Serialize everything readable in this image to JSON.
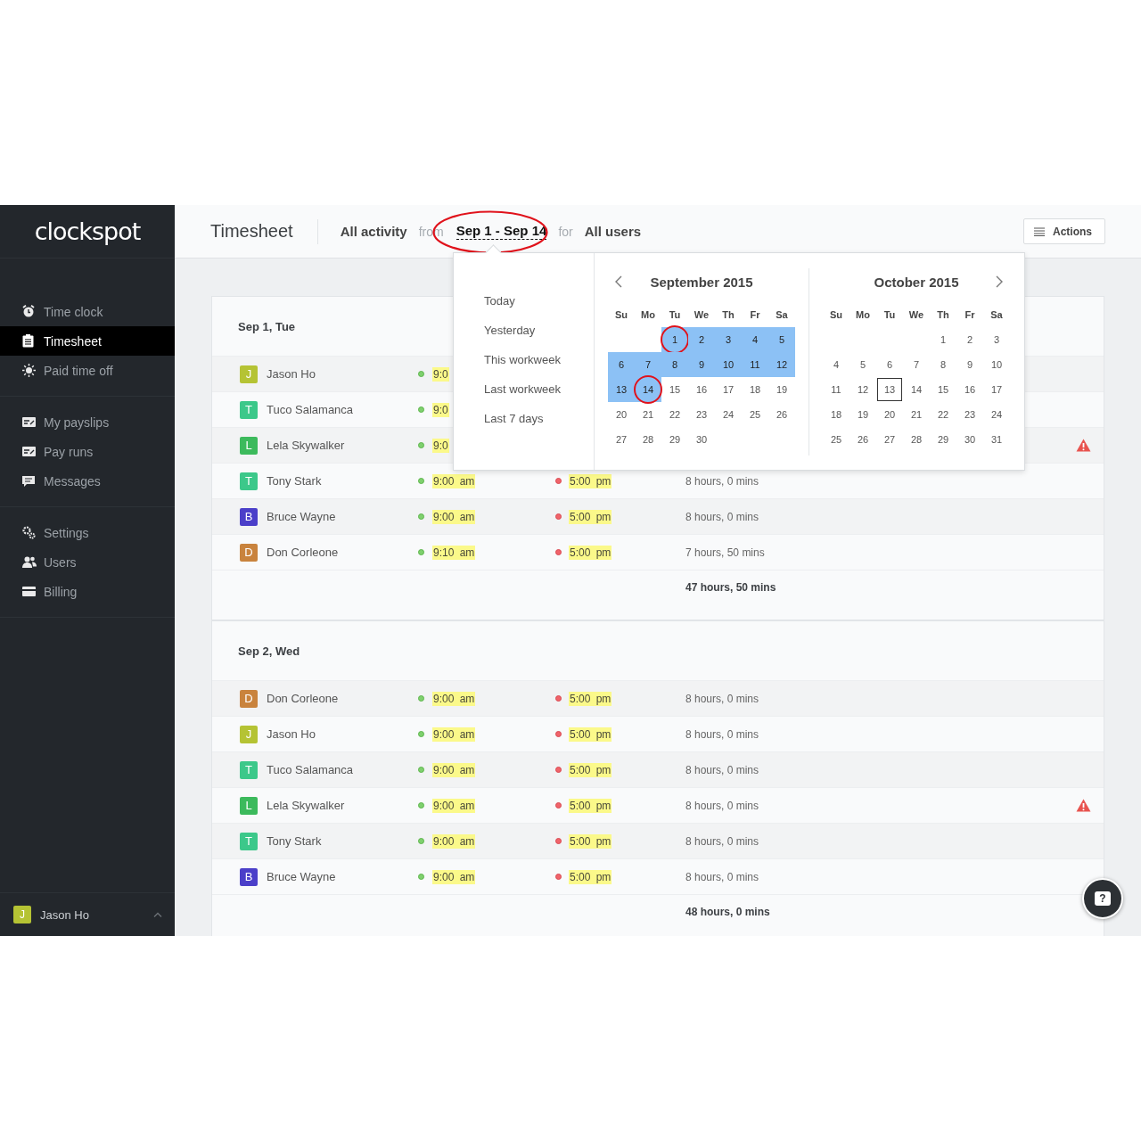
{
  "sidebar": {
    "logo": "clockspot",
    "groups": [
      {
        "items": [
          {
            "label": "Time clock",
            "selected": false
          },
          {
            "label": "Timesheet",
            "selected": true
          },
          {
            "label": "Paid time off",
            "selected": false
          }
        ]
      },
      {
        "items": [
          {
            "label": "My payslips",
            "selected": false
          },
          {
            "label": "Pay runs",
            "selected": false
          },
          {
            "label": "Messages",
            "selected": false
          }
        ]
      },
      {
        "items": [
          {
            "label": "Settings",
            "selected": false
          },
          {
            "label": "Users",
            "selected": false
          },
          {
            "label": "Billing",
            "selected": false
          }
        ]
      }
    ],
    "user": {
      "initial": "J",
      "name": "Jason Ho",
      "color": "#b5c334"
    }
  },
  "header": {
    "title": "Timesheet",
    "activity": "All activity",
    "from": "from",
    "range": "Sep 1 - Sep 14",
    "range_circled": true,
    "for": "for",
    "users": "All users",
    "actions": "Actions"
  },
  "days": [
    {
      "title": "Sep 1, Tue",
      "rows": [
        {
          "initial": "J",
          "name": "Jason Ho",
          "color": "#b5c334",
          "time_in": "9:0",
          "warning": false
        },
        {
          "initial": "T",
          "name": "Tuco Salamanca",
          "color": "#3cc88a",
          "time_in": "9:0",
          "warning": false
        },
        {
          "initial": "L",
          "name": "Lela Skywalker",
          "color": "#3cba5c",
          "time_in": "9:0",
          "warning": true
        },
        {
          "initial": "T",
          "name": "Tony Stark",
          "color": "#3cc88a",
          "time_in": "9:00 am",
          "time_out": "5:00 pm",
          "duration": "8 hours, 0 mins",
          "warning": false
        },
        {
          "initial": "B",
          "name": "Bruce Wayne",
          "color": "#4b3fc9",
          "time_in": "9:00 am",
          "time_out": "5:00 pm",
          "duration": "8 hours, 0 mins",
          "warning": false
        },
        {
          "initial": "D",
          "name": "Don Corleone",
          "color": "#c9833d",
          "time_in": "9:10 am",
          "time_out": "5:00 pm",
          "duration": "7 hours, 50 mins",
          "warning": false
        }
      ],
      "total": "47 hours, 50 mins"
    },
    {
      "title": "Sep 2, Wed",
      "rows": [
        {
          "initial": "D",
          "name": "Don Corleone",
          "color": "#c9833d",
          "time_in": "9:00 am",
          "time_out": "5:00 pm",
          "duration": "8 hours, 0 mins",
          "warning": false
        },
        {
          "initial": "J",
          "name": "Jason Ho",
          "color": "#b5c334",
          "time_in": "9:00 am",
          "time_out": "5:00 pm",
          "duration": "8 hours, 0 mins",
          "warning": false
        },
        {
          "initial": "T",
          "name": "Tuco Salamanca",
          "color": "#3cc88a",
          "time_in": "9:00 am",
          "time_out": "5:00 pm",
          "duration": "8 hours, 0 mins",
          "warning": false
        },
        {
          "initial": "L",
          "name": "Lela Skywalker",
          "color": "#3cba5c",
          "time_in": "9:00 am",
          "time_out": "5:00 pm",
          "duration": "8 hours, 0 mins",
          "warning": true
        },
        {
          "initial": "T",
          "name": "Tony Stark",
          "color": "#3cc88a",
          "time_in": "9:00 am",
          "time_out": "5:00 pm",
          "duration": "8 hours, 0 mins",
          "warning": false
        },
        {
          "initial": "B",
          "name": "Bruce Wayne",
          "color": "#4b3fc9",
          "time_in": "9:00 am",
          "time_out": "5:00 pm",
          "duration": "8 hours, 0 mins",
          "warning": false
        }
      ],
      "total": "48 hours, 0 mins"
    }
  ],
  "datepicker": {
    "presets": [
      "Today",
      "Yesterday",
      "This workweek",
      "Last workweek",
      "Last 7 days"
    ],
    "months": [
      {
        "title": "September 2015",
        "weekdays": [
          "Su",
          "Mo",
          "Tu",
          "We",
          "Th",
          "Fr",
          "Sa"
        ],
        "weeks": [
          [
            {
              "d": "1",
              "in_range": true,
              "circled": true,
              "today": false
            },
            {
              "d": "2",
              "in_range": true,
              "circled": false,
              "today": false
            },
            {
              "d": "3",
              "in_range": true,
              "circled": false,
              "today": false
            },
            {
              "d": "4",
              "in_range": true,
              "circled": false,
              "today": false
            },
            {
              "d": "5",
              "in_range": true,
              "circled": false,
              "today": false
            }
          ],
          [
            {
              "d": "6",
              "in_range": true,
              "circled": false,
              "today": false
            },
            {
              "d": "7",
              "in_range": true,
              "circled": false,
              "today": false
            },
            {
              "d": "8",
              "in_range": true,
              "circled": false,
              "today": false
            },
            {
              "d": "9",
              "in_range": true,
              "circled": false,
              "today": false
            },
            {
              "d": "10",
              "in_range": true,
              "circled": false,
              "today": false
            },
            {
              "d": "11",
              "in_range": true,
              "circled": false,
              "today": false
            },
            {
              "d": "12",
              "in_range": true,
              "circled": false,
              "today": false
            }
          ],
          [
            {
              "d": "13",
              "in_range": true,
              "circled": false,
              "today": false
            },
            {
              "d": "14",
              "in_range": true,
              "circled": true,
              "today": false
            },
            {
              "d": "15",
              "in_range": false,
              "circled": false,
              "today": false
            },
            {
              "d": "16",
              "in_range": false,
              "circled": false,
              "today": false
            },
            {
              "d": "17",
              "in_range": false,
              "circled": false,
              "today": false
            },
            {
              "d": "18",
              "in_range": false,
              "circled": false,
              "today": false
            },
            {
              "d": "19",
              "in_range": false,
              "circled": false,
              "today": false
            }
          ],
          [
            {
              "d": "20",
              "in_range": false,
              "circled": false,
              "today": false
            },
            {
              "d": "21",
              "in_range": false,
              "circled": false,
              "today": false
            },
            {
              "d": "22",
              "in_range": false,
              "circled": false,
              "today": false
            },
            {
              "d": "23",
              "in_range": false,
              "circled": false,
              "today": false
            },
            {
              "d": "24",
              "in_range": false,
              "circled": false,
              "today": false
            },
            {
              "d": "25",
              "in_range": false,
              "circled": false,
              "today": false
            },
            {
              "d": "26",
              "in_range": false,
              "circled": false,
              "today": false
            }
          ],
          [
            {
              "d": "27",
              "in_range": false,
              "circled": false,
              "today": false
            },
            {
              "d": "28",
              "in_range": false,
              "circled": false,
              "today": false
            },
            {
              "d": "29",
              "in_range": false,
              "circled": false,
              "today": false
            },
            {
              "d": "30",
              "in_range": false,
              "circled": false,
              "today": false
            }
          ]
        ]
      },
      {
        "title": "October 2015",
        "weekdays": [
          "Su",
          "Mo",
          "Tu",
          "We",
          "Th",
          "Fr",
          "Sa"
        ],
        "weeks": [
          [
            {
              "d": "1",
              "in_range": false,
              "circled": false,
              "today": false
            },
            {
              "d": "2",
              "in_range": false,
              "circled": false,
              "today": false
            },
            {
              "d": "3",
              "in_range": false,
              "circled": false,
              "today": false
            }
          ],
          [
            {
              "d": "4",
              "in_range": false,
              "circled": false,
              "today": false
            },
            {
              "d": "5",
              "in_range": false,
              "circled": false,
              "today": false
            },
            {
              "d": "6",
              "in_range": false,
              "circled": false,
              "today": false
            },
            {
              "d": "7",
              "in_range": false,
              "circled": false,
              "today": false
            },
            {
              "d": "8",
              "in_range": false,
              "circled": false,
              "today": false
            },
            {
              "d": "9",
              "in_range": false,
              "circled": false,
              "today": false
            },
            {
              "d": "10",
              "in_range": false,
              "circled": false,
              "today": false
            }
          ],
          [
            {
              "d": "11",
              "in_range": false,
              "circled": false,
              "today": false
            },
            {
              "d": "12",
              "in_range": false,
              "circled": false,
              "today": false
            },
            {
              "d": "13",
              "in_range": false,
              "circled": false,
              "today": true
            },
            {
              "d": "14",
              "in_range": false,
              "circled": false,
              "today": false
            },
            {
              "d": "15",
              "in_range": false,
              "circled": false,
              "today": false
            },
            {
              "d": "16",
              "in_range": false,
              "circled": false,
              "today": false
            },
            {
              "d": "17",
              "in_range": false,
              "circled": false,
              "today": false
            }
          ],
          [
            {
              "d": "18",
              "in_range": false,
              "circled": false,
              "today": false
            },
            {
              "d": "19",
              "in_range": false,
              "circled": false,
              "today": false
            },
            {
              "d": "20",
              "in_range": false,
              "circled": false,
              "today": false
            },
            {
              "d": "21",
              "in_range": false,
              "circled": false,
              "today": false
            },
            {
              "d": "22",
              "in_range": false,
              "circled": false,
              "today": false
            },
            {
              "d": "23",
              "in_range": false,
              "circled": false,
              "today": false
            },
            {
              "d": "24",
              "in_range": false,
              "circled": false,
              "today": false
            }
          ],
          [
            {
              "d": "25",
              "in_range": false,
              "circled": false,
              "today": false
            },
            {
              "d": "26",
              "in_range": false,
              "circled": false,
              "today": false
            },
            {
              "d": "27",
              "in_range": false,
              "circled": false,
              "today": false
            },
            {
              "d": "28",
              "in_range": false,
              "circled": false,
              "today": false
            },
            {
              "d": "29",
              "in_range": false,
              "circled": false,
              "today": false
            },
            {
              "d": "30",
              "in_range": false,
              "circled": false,
              "today": false
            },
            {
              "d": "31",
              "in_range": false,
              "circled": false,
              "today": false
            }
          ]
        ]
      }
    ]
  },
  "help": {
    "label": "?"
  }
}
